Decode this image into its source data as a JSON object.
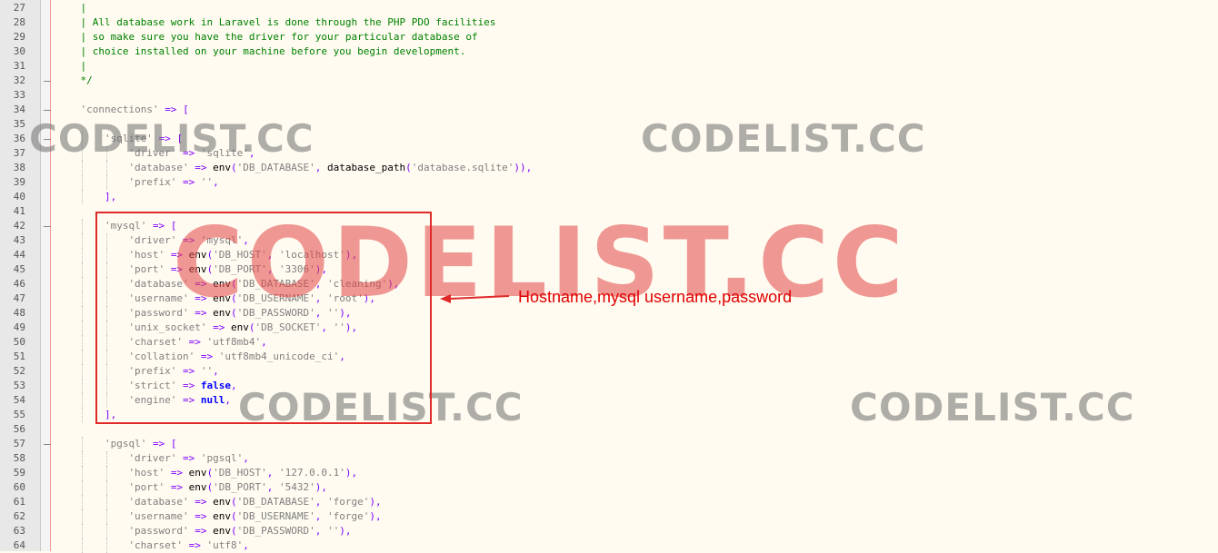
{
  "editor": {
    "lines": [
      {
        "num": "27",
        "indent": 2,
        "tokens": [
          {
            "t": "cm",
            "v": "|"
          }
        ]
      },
      {
        "num": "28",
        "indent": 2,
        "tokens": [
          {
            "t": "cm",
            "v": "| All database work in Laravel is done through the PHP PDO facilities"
          }
        ]
      },
      {
        "num": "29",
        "indent": 2,
        "tokens": [
          {
            "t": "cm",
            "v": "| so make sure you have the driver for your particular database of"
          }
        ]
      },
      {
        "num": "30",
        "indent": 2,
        "tokens": [
          {
            "t": "cm",
            "v": "| choice installed on your machine before you begin development."
          }
        ]
      },
      {
        "num": "31",
        "indent": 2,
        "tokens": [
          {
            "t": "cm",
            "v": "|"
          }
        ]
      },
      {
        "num": "32",
        "indent": 2,
        "tokens": [
          {
            "t": "cm",
            "v": "*/"
          }
        ]
      },
      {
        "num": "33",
        "indent": 0,
        "tokens": []
      },
      {
        "num": "34",
        "indent": 2,
        "tokens": [
          {
            "t": "str",
            "v": "'connections'"
          },
          {
            "t": "pl",
            "v": " "
          },
          {
            "t": "op",
            "v": "=>"
          },
          {
            "t": "pl",
            "v": " "
          },
          {
            "t": "op",
            "v": "["
          }
        ]
      },
      {
        "num": "35",
        "indent": 0,
        "tokens": []
      },
      {
        "num": "36",
        "indent": 4,
        "tokens": [
          {
            "t": "str",
            "v": "'sqlite'"
          },
          {
            "t": "pl",
            "v": " "
          },
          {
            "t": "op",
            "v": "=>"
          },
          {
            "t": "pl",
            "v": " "
          },
          {
            "t": "op",
            "v": "["
          }
        ]
      },
      {
        "num": "37",
        "indent": 6,
        "tokens": [
          {
            "t": "str",
            "v": "'driver'"
          },
          {
            "t": "pl",
            "v": " "
          },
          {
            "t": "op",
            "v": "=>"
          },
          {
            "t": "pl",
            "v": " "
          },
          {
            "t": "str",
            "v": "'sqlite'"
          },
          {
            "t": "op",
            "v": ","
          }
        ]
      },
      {
        "num": "38",
        "indent": 6,
        "tokens": [
          {
            "t": "str",
            "v": "'database'"
          },
          {
            "t": "pl",
            "v": " "
          },
          {
            "t": "op",
            "v": "=>"
          },
          {
            "t": "pl",
            "v": " env"
          },
          {
            "t": "op",
            "v": "("
          },
          {
            "t": "str",
            "v": "'DB_DATABASE'"
          },
          {
            "t": "op",
            "v": ","
          },
          {
            "t": "pl",
            "v": " database_path"
          },
          {
            "t": "op",
            "v": "("
          },
          {
            "t": "str",
            "v": "'database.sqlite'"
          },
          {
            "t": "op",
            "v": ")),"
          }
        ]
      },
      {
        "num": "39",
        "indent": 6,
        "tokens": [
          {
            "t": "str",
            "v": "'prefix'"
          },
          {
            "t": "pl",
            "v": " "
          },
          {
            "t": "op",
            "v": "=>"
          },
          {
            "t": "pl",
            "v": " "
          },
          {
            "t": "str",
            "v": "''"
          },
          {
            "t": "op",
            "v": ","
          }
        ]
      },
      {
        "num": "40",
        "indent": 4,
        "tokens": [
          {
            "t": "op",
            "v": "],"
          }
        ]
      },
      {
        "num": "41",
        "indent": 0,
        "tokens": []
      },
      {
        "num": "42",
        "indent": 4,
        "tokens": [
          {
            "t": "str",
            "v": "'mysql'"
          },
          {
            "t": "pl",
            "v": " "
          },
          {
            "t": "op",
            "v": "=>"
          },
          {
            "t": "pl",
            "v": " "
          },
          {
            "t": "op",
            "v": "["
          }
        ]
      },
      {
        "num": "43",
        "indent": 6,
        "tokens": [
          {
            "t": "str",
            "v": "'driver'"
          },
          {
            "t": "pl",
            "v": " "
          },
          {
            "t": "op",
            "v": "=>"
          },
          {
            "t": "pl",
            "v": " "
          },
          {
            "t": "str",
            "v": "'mysql'"
          },
          {
            "t": "op",
            "v": ","
          }
        ]
      },
      {
        "num": "44",
        "indent": 6,
        "tokens": [
          {
            "t": "str",
            "v": "'host'"
          },
          {
            "t": "pl",
            "v": " "
          },
          {
            "t": "op",
            "v": "=>"
          },
          {
            "t": "pl",
            "v": " env"
          },
          {
            "t": "op",
            "v": "("
          },
          {
            "t": "str",
            "v": "'DB_HOST'"
          },
          {
            "t": "op",
            "v": ","
          },
          {
            "t": "pl",
            "v": " "
          },
          {
            "t": "str",
            "v": "'localhost'"
          },
          {
            "t": "op",
            "v": "),"
          }
        ]
      },
      {
        "num": "45",
        "indent": 6,
        "tokens": [
          {
            "t": "str",
            "v": "'port'"
          },
          {
            "t": "pl",
            "v": " "
          },
          {
            "t": "op",
            "v": "=>"
          },
          {
            "t": "pl",
            "v": " env"
          },
          {
            "t": "op",
            "v": "("
          },
          {
            "t": "str",
            "v": "'DB_PORT'"
          },
          {
            "t": "op",
            "v": ","
          },
          {
            "t": "pl",
            "v": " "
          },
          {
            "t": "str",
            "v": "'3306'"
          },
          {
            "t": "op",
            "v": "),"
          }
        ]
      },
      {
        "num": "46",
        "indent": 6,
        "tokens": [
          {
            "t": "str",
            "v": "'database'"
          },
          {
            "t": "pl",
            "v": " "
          },
          {
            "t": "op",
            "v": "=>"
          },
          {
            "t": "pl",
            "v": " env"
          },
          {
            "t": "op",
            "v": "("
          },
          {
            "t": "str",
            "v": "'DB_DATABASE'"
          },
          {
            "t": "op",
            "v": ","
          },
          {
            "t": "pl",
            "v": " "
          },
          {
            "t": "str",
            "v": "'cleaning'"
          },
          {
            "t": "op",
            "v": "),"
          }
        ]
      },
      {
        "num": "47",
        "indent": 6,
        "tokens": [
          {
            "t": "str",
            "v": "'username'"
          },
          {
            "t": "pl",
            "v": " "
          },
          {
            "t": "op",
            "v": "=>"
          },
          {
            "t": "pl",
            "v": " env"
          },
          {
            "t": "op",
            "v": "("
          },
          {
            "t": "str",
            "v": "'DB_USERNAME'"
          },
          {
            "t": "op",
            "v": ","
          },
          {
            "t": "pl",
            "v": " "
          },
          {
            "t": "str",
            "v": "'root'"
          },
          {
            "t": "op",
            "v": "),"
          }
        ]
      },
      {
        "num": "48",
        "indent": 6,
        "tokens": [
          {
            "t": "str",
            "v": "'password'"
          },
          {
            "t": "pl",
            "v": " "
          },
          {
            "t": "op",
            "v": "=>"
          },
          {
            "t": "pl",
            "v": " env"
          },
          {
            "t": "op",
            "v": "("
          },
          {
            "t": "str",
            "v": "'DB_PASSWORD'"
          },
          {
            "t": "op",
            "v": ","
          },
          {
            "t": "pl",
            "v": " "
          },
          {
            "t": "str",
            "v": "''"
          },
          {
            "t": "op",
            "v": "),"
          }
        ]
      },
      {
        "num": "49",
        "indent": 6,
        "tokens": [
          {
            "t": "str",
            "v": "'unix_socket'"
          },
          {
            "t": "pl",
            "v": " "
          },
          {
            "t": "op",
            "v": "=>"
          },
          {
            "t": "pl",
            "v": " env"
          },
          {
            "t": "op",
            "v": "("
          },
          {
            "t": "str",
            "v": "'DB_SOCKET'"
          },
          {
            "t": "op",
            "v": ","
          },
          {
            "t": "pl",
            "v": " "
          },
          {
            "t": "str",
            "v": "''"
          },
          {
            "t": "op",
            "v": "),"
          }
        ]
      },
      {
        "num": "50",
        "indent": 6,
        "tokens": [
          {
            "t": "str",
            "v": "'charset'"
          },
          {
            "t": "pl",
            "v": " "
          },
          {
            "t": "op",
            "v": "=>"
          },
          {
            "t": "pl",
            "v": " "
          },
          {
            "t": "str",
            "v": "'utf8mb4'"
          },
          {
            "t": "op",
            "v": ","
          }
        ]
      },
      {
        "num": "51",
        "indent": 6,
        "tokens": [
          {
            "t": "str",
            "v": "'collation'"
          },
          {
            "t": "pl",
            "v": " "
          },
          {
            "t": "op",
            "v": "=>"
          },
          {
            "t": "pl",
            "v": " "
          },
          {
            "t": "str",
            "v": "'utf8mb4_unicode_ci'"
          },
          {
            "t": "op",
            "v": ","
          }
        ]
      },
      {
        "num": "52",
        "indent": 6,
        "tokens": [
          {
            "t": "str",
            "v": "'prefix'"
          },
          {
            "t": "pl",
            "v": " "
          },
          {
            "t": "op",
            "v": "=>"
          },
          {
            "t": "pl",
            "v": " "
          },
          {
            "t": "str",
            "v": "''"
          },
          {
            "t": "op",
            "v": ","
          }
        ]
      },
      {
        "num": "53",
        "indent": 6,
        "tokens": [
          {
            "t": "str",
            "v": "'strict'"
          },
          {
            "t": "pl",
            "v": " "
          },
          {
            "t": "op",
            "v": "=>"
          },
          {
            "t": "pl",
            "v": " "
          },
          {
            "t": "kw",
            "v": "false"
          },
          {
            "t": "op",
            "v": ","
          }
        ]
      },
      {
        "num": "54",
        "indent": 6,
        "tokens": [
          {
            "t": "str",
            "v": "'engine'"
          },
          {
            "t": "pl",
            "v": " "
          },
          {
            "t": "op",
            "v": "=>"
          },
          {
            "t": "pl",
            "v": " "
          },
          {
            "t": "kw",
            "v": "null"
          },
          {
            "t": "op",
            "v": ","
          }
        ]
      },
      {
        "num": "55",
        "indent": 4,
        "tokens": [
          {
            "t": "op",
            "v": "],"
          }
        ]
      },
      {
        "num": "56",
        "indent": 0,
        "tokens": []
      },
      {
        "num": "57",
        "indent": 4,
        "tokens": [
          {
            "t": "str",
            "v": "'pgsql'"
          },
          {
            "t": "pl",
            "v": " "
          },
          {
            "t": "op",
            "v": "=>"
          },
          {
            "t": "pl",
            "v": " "
          },
          {
            "t": "op",
            "v": "["
          }
        ]
      },
      {
        "num": "58",
        "indent": 6,
        "tokens": [
          {
            "t": "str",
            "v": "'driver'"
          },
          {
            "t": "pl",
            "v": " "
          },
          {
            "t": "op",
            "v": "=>"
          },
          {
            "t": "pl",
            "v": " "
          },
          {
            "t": "str",
            "v": "'pgsql'"
          },
          {
            "t": "op",
            "v": ","
          }
        ]
      },
      {
        "num": "59",
        "indent": 6,
        "tokens": [
          {
            "t": "str",
            "v": "'host'"
          },
          {
            "t": "pl",
            "v": " "
          },
          {
            "t": "op",
            "v": "=>"
          },
          {
            "t": "pl",
            "v": " env"
          },
          {
            "t": "op",
            "v": "("
          },
          {
            "t": "str",
            "v": "'DB_HOST'"
          },
          {
            "t": "op",
            "v": ","
          },
          {
            "t": "pl",
            "v": " "
          },
          {
            "t": "str",
            "v": "'127.0.0.1'"
          },
          {
            "t": "op",
            "v": "),"
          }
        ]
      },
      {
        "num": "60",
        "indent": 6,
        "tokens": [
          {
            "t": "str",
            "v": "'port'"
          },
          {
            "t": "pl",
            "v": " "
          },
          {
            "t": "op",
            "v": "=>"
          },
          {
            "t": "pl",
            "v": " env"
          },
          {
            "t": "op",
            "v": "("
          },
          {
            "t": "str",
            "v": "'DB_PORT'"
          },
          {
            "t": "op",
            "v": ","
          },
          {
            "t": "pl",
            "v": " "
          },
          {
            "t": "str",
            "v": "'5432'"
          },
          {
            "t": "op",
            "v": "),"
          }
        ]
      },
      {
        "num": "61",
        "indent": 6,
        "tokens": [
          {
            "t": "str",
            "v": "'database'"
          },
          {
            "t": "pl",
            "v": " "
          },
          {
            "t": "op",
            "v": "=>"
          },
          {
            "t": "pl",
            "v": " env"
          },
          {
            "t": "op",
            "v": "("
          },
          {
            "t": "str",
            "v": "'DB_DATABASE'"
          },
          {
            "t": "op",
            "v": ","
          },
          {
            "t": "pl",
            "v": " "
          },
          {
            "t": "str",
            "v": "'forge'"
          },
          {
            "t": "op",
            "v": "),"
          }
        ]
      },
      {
        "num": "62",
        "indent": 6,
        "tokens": [
          {
            "t": "str",
            "v": "'username'"
          },
          {
            "t": "pl",
            "v": " "
          },
          {
            "t": "op",
            "v": "=>"
          },
          {
            "t": "pl",
            "v": " env"
          },
          {
            "t": "op",
            "v": "("
          },
          {
            "t": "str",
            "v": "'DB_USERNAME'"
          },
          {
            "t": "op",
            "v": ","
          },
          {
            "t": "pl",
            "v": " "
          },
          {
            "t": "str",
            "v": "'forge'"
          },
          {
            "t": "op",
            "v": "),"
          }
        ]
      },
      {
        "num": "63",
        "indent": 6,
        "tokens": [
          {
            "t": "str",
            "v": "'password'"
          },
          {
            "t": "pl",
            "v": " "
          },
          {
            "t": "op",
            "v": "=>"
          },
          {
            "t": "pl",
            "v": " env"
          },
          {
            "t": "op",
            "v": "("
          },
          {
            "t": "str",
            "v": "'DB_PASSWORD'"
          },
          {
            "t": "op",
            "v": ","
          },
          {
            "t": "pl",
            "v": " "
          },
          {
            "t": "str",
            "v": "''"
          },
          {
            "t": "op",
            "v": "),"
          }
        ]
      },
      {
        "num": "64",
        "indent": 6,
        "tokens": [
          {
            "t": "str",
            "v": "'charset'"
          },
          {
            "t": "pl",
            "v": " "
          },
          {
            "t": "op",
            "v": "=>"
          },
          {
            "t": "pl",
            "v": " "
          },
          {
            "t": "str",
            "v": "'utf8'"
          },
          {
            "t": "op",
            "v": ","
          }
        ]
      }
    ]
  },
  "annotation": {
    "text": "Hostname,mysql username,password"
  },
  "watermarks": {
    "gray_text": "CODELIST.CC",
    "red_text": "CODELIST.CC"
  },
  "colors": {
    "comment": "#008000",
    "string": "#808080",
    "operator": "#8000ff",
    "keyword": "#0000ff",
    "highlight_box": "#e02a2a"
  }
}
